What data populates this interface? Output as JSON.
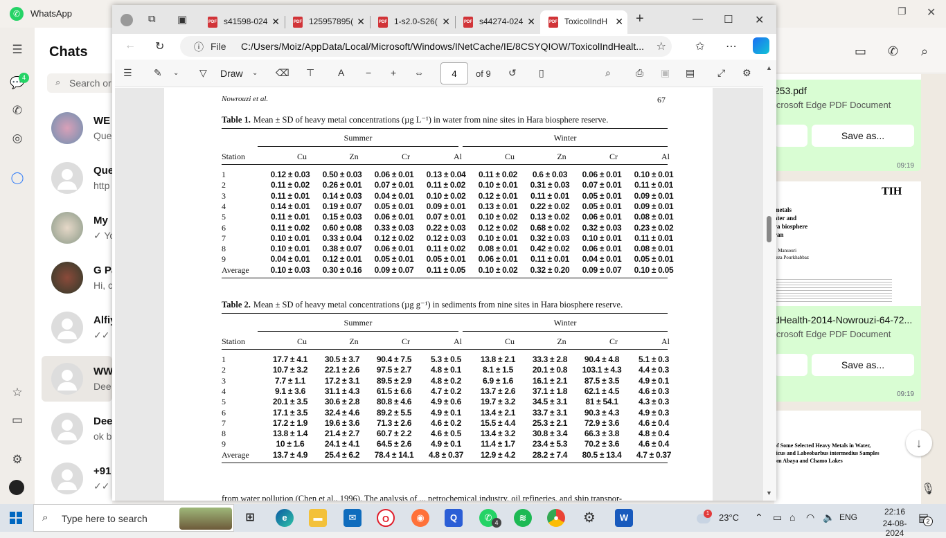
{
  "whatsapp": {
    "title": "WhatsApp",
    "chats_title": "Chats",
    "search_placeholder": "Search or",
    "chat_badge": "4",
    "chats": [
      {
        "name": "WE",
        "preview": "Que"
      },
      {
        "name": "Que",
        "preview": "http"
      },
      {
        "name": "My",
        "preview": "✓ Yo"
      },
      {
        "name": "G Pa",
        "preview": "Hi, c"
      },
      {
        "name": "Alfiy",
        "preview": "✓✓ Y"
      },
      {
        "name": "WW",
        "preview": "Dee"
      },
      {
        "name": "Dee",
        "preview": "ok b"
      },
      {
        "name": "+91",
        "preview": "✓✓ T"
      }
    ],
    "conversation": {
      "messages": [
        {
          "file": "253.pdf",
          "type": "icrosoft Edge PDF Document",
          "button": "Save as...",
          "time": "09:19"
        },
        {
          "file": "dHealth-2014-Nowrouzi-64-72...",
          "type": "icrosoft Edge PDF Document",
          "button": "Save as...",
          "time": "09:19",
          "thumb_logo": "TIH",
          "thumb_lines": [
            "metals",
            "ater and",
            "ra biosphere",
            "ran",
            "n Mansouri",
            "reza Pourkhabbaz"
          ]
        },
        {
          "thumb_lines": [
            "of Some Selected Heavy Metals in Water,",
            "ticus and Labeobarbus intermedius Samples",
            "om Abaya and Chamo Lakes"
          ]
        }
      ]
    }
  },
  "edge": {
    "tabs": [
      {
        "label": "s41598-024",
        "active": false
      },
      {
        "label": "125957895(",
        "active": false
      },
      {
        "label": "1-s2.0-S26(",
        "active": false
      },
      {
        "label": "s44274-024",
        "active": false
      },
      {
        "label": "ToxicolIndH",
        "active": true
      }
    ],
    "address": {
      "scheme_label": "File",
      "url": "C:/Users/Moiz/AppData/Local/Microsoft/Windows/INetCache/IE/8CSYQIOW/ToxicolIndHealt..."
    },
    "pdf_toolbar": {
      "draw_label": "Draw",
      "page_current": "4",
      "page_total": "of 9"
    }
  },
  "document": {
    "running_author": "Nowrouzi et al.",
    "page_number": "67",
    "tables": [
      {
        "caption_label": "Table 1.",
        "caption_text": "Mean ± SD of heavy metal concentrations (µg L⁻¹) in water from nine sites in Hara biosphere reserve.",
        "season_summer": "Summer",
        "season_winter": "Winter",
        "station_header": "Station",
        "columns": [
          "Cu",
          "Zn",
          "Cr",
          "Al",
          "Cu",
          "Zn",
          "Cr",
          "Al"
        ],
        "rows": [
          {
            "station": "1",
            "values": [
              "0.12 ± 0.03",
              "0.50 ± 0.03",
              "0.06 ± 0.01",
              "0.13 ± 0.04",
              "0.11 ± 0.02",
              "0.6 ± 0.03",
              "0.06 ± 0.01",
              "0.10 ± 0.01"
            ]
          },
          {
            "station": "2",
            "values": [
              "0.11 ± 0.02",
              "0.26 ± 0.01",
              "0.07 ± 0.01",
              "0.11 ± 0.02",
              "0.10 ± 0.01",
              "0.31 ± 0.03",
              "0.07 ± 0.01",
              "0.11 ± 0.01"
            ]
          },
          {
            "station": "3",
            "values": [
              "0.11 ± 0.01",
              "0.14 ± 0.03",
              "0.04 ± 0.01",
              "0.10 ± 0.02",
              "0.12 ± 0.01",
              "0.11 ± 0.01",
              "0.05 ± 0.01",
              "0.09 ± 0.01"
            ]
          },
          {
            "station": "4",
            "values": [
              "0.14 ± 0.01",
              "0.19 ± 0.07",
              "0.05 ± 0.01",
              "0.09 ± 0.01",
              "0.13 ± 0.01",
              "0.22 ± 0.02",
              "0.05 ± 0.01",
              "0.09 ± 0.01"
            ]
          },
          {
            "station": "5",
            "values": [
              "0.11 ± 0.01",
              "0.15 ± 0.03",
              "0.06 ± 0.01",
              "0.07 ± 0.01",
              "0.10 ± 0.02",
              "0.13 ± 0.02",
              "0.06 ± 0.01",
              "0.08 ± 0.01"
            ]
          },
          {
            "station": "6",
            "values": [
              "0.11 ± 0.02",
              "0.60 ± 0.08",
              "0.33 ± 0.03",
              "0.22 ± 0.03",
              "0.12 ± 0.02",
              "0.68 ± 0.02",
              "0.32 ± 0.03",
              "0.23 ± 0.02"
            ]
          },
          {
            "station": "7",
            "values": [
              "0.10 ± 0.01",
              "0.33 ± 0.04",
              "0.12 ± 0.02",
              "0.12 ± 0.03",
              "0.10 ± 0.01",
              "0.32 ± 0.03",
              "0.10 ± 0.01",
              "0.11 ± 0.01"
            ]
          },
          {
            "station": "8",
            "values": [
              "0.10 ± 0.01",
              "0.38 ± 0.07",
              "0.06 ± 0.01",
              "0.11 ± 0.02",
              "0.08 ± 0.01",
              "0.42 ± 0.02",
              "0.06 ± 0.01",
              "0.08 ± 0.01"
            ]
          },
          {
            "station": "9",
            "values": [
              "0.04 ± 0.01",
              "0.12 ± 0.01",
              "0.05 ± 0.01",
              "0.05 ± 0.01",
              "0.06 ± 0.01",
              "0.11 ± 0.01",
              "0.04 ± 0.01",
              "0.05 ± 0.01"
            ]
          },
          {
            "station": "Average",
            "values": [
              "0.10 ± 0.03",
              "0.30 ± 0.16",
              "0.09 ± 0.07",
              "0.11 ± 0.05",
              "0.10 ± 0.02",
              "0.32 ± 0.20",
              "0.09 ± 0.07",
              "0.10 ± 0.05"
            ]
          }
        ]
      },
      {
        "caption_label": "Table 2.",
        "caption_text": "Mean ± SD of heavy metal concentrations (µg g⁻¹) in sediments from nine sites in Hara biosphere reserve.",
        "season_summer": "Summer",
        "season_winter": "Winter",
        "station_header": "Station",
        "columns": [
          "Cu",
          "Zn",
          "Cr",
          "Al",
          "Cu",
          "Zn",
          "Cr",
          "Al"
        ],
        "rows": [
          {
            "station": "1",
            "values": [
              "17.7 ± 4.1",
              "30.5 ± 3.7",
              "90.4 ± 7.5",
              "5.3 ± 0.5",
              "13.8 ± 2.1",
              "33.3 ± 2.8",
              "90.4 ± 4.8",
              "5.1 ± 0.3"
            ]
          },
          {
            "station": "2",
            "values": [
              "10.7 ± 3.2",
              "22.1 ± 2.6",
              "97.5 ± 2.7",
              "4.8 ± 0.1",
              "8.1 ± 1.5",
              "20.1 ± 0.8",
              "103.1 ± 4.3",
              "4.4 ± 0.3"
            ]
          },
          {
            "station": "3",
            "values": [
              "7.7 ± 1.1",
              "17.2 ± 3.1",
              "89.5 ± 2.9",
              "4.8 ± 0.2",
              "6.9 ± 1.6",
              "16.1 ± 2.1",
              "87.5 ± 3.5",
              "4.9 ± 0.1"
            ]
          },
          {
            "station": "4",
            "values": [
              "9.1 ± 3.6",
              "31.1 ± 4.3",
              "61.5 ± 6.6",
              "4.7 ± 0.2",
              "13.7 ± 2.6",
              "37.1 ± 1.8",
              "62.1 ± 4.5",
              "4.6 ± 0.3"
            ]
          },
          {
            "station": "5",
            "values": [
              "20.1 ± 3.5",
              "30.6 ± 2.8",
              "80.8 ± 4.6",
              "4.9 ± 0.6",
              "19.7 ± 3.2",
              "34.5 ± 3.1",
              "81 ± 54.1",
              "4.3 ± 0.3"
            ]
          },
          {
            "station": "6",
            "values": [
              "17.1 ± 3.5",
              "32.4 ± 4.6",
              "89.2 ± 5.5",
              "4.9 ± 0.1",
              "13.4 ± 2.1",
              "33.7 ± 3.1",
              "90.3 ± 4.3",
              "4.9 ± 0.3"
            ]
          },
          {
            "station": "7",
            "values": [
              "17.2 ± 1.9",
              "19.6 ± 3.6",
              "71.3 ± 2.6",
              "4.6 ± 0.2",
              "15.5 ± 4.4",
              "25.3 ± 2.1",
              "72.9 ± 3.6",
              "4.6 ± 0.4"
            ]
          },
          {
            "station": "8",
            "values": [
              "13.8 ± 1.4",
              "21.4 ± 2.7",
              "60.7 ± 2.2",
              "4.6 ± 0.5",
              "13.4 ± 3.2",
              "30.8 ± 3.4",
              "66.3 ± 3.8",
              "4.8 ± 0.4"
            ]
          },
          {
            "station": "9",
            "values": [
              "10 ± 1.6",
              "24.1 ± 4.1",
              "64.5 ± 2.6",
              "4.9 ± 0.1",
              "11.4 ± 1.7",
              "23.4 ± 5.3",
              "70.2 ± 3.6",
              "4.6 ± 0.4"
            ]
          },
          {
            "station": "Average",
            "values": [
              "13.7 ± 4.9",
              "25.4 ± 6.2",
              "78.4 ± 14.1",
              "4.8 ± 0.37",
              "12.9 ± 4.2",
              "28.2 ± 7.4",
              "80.5 ± 13.4",
              "4.7 ± 0.37"
            ]
          }
        ]
      }
    ],
    "footer_text": "from water pollution (Chen et al., 1996). The analysis of ... petrochemical industry, oil refineries, and ship transpor-"
  },
  "taskbar": {
    "search_placeholder": "Type here to search",
    "whatsapp_badge": "4",
    "temperature": "23°C",
    "weather_alert": "1",
    "language": "ENG",
    "time": "22:16",
    "date": "24-08-2024",
    "notification_count": "2"
  },
  "colors": {
    "whatsapp_green": "#25d366",
    "edge_pdf_red": "#d13438",
    "message_bubble": "#d9fdd3"
  }
}
